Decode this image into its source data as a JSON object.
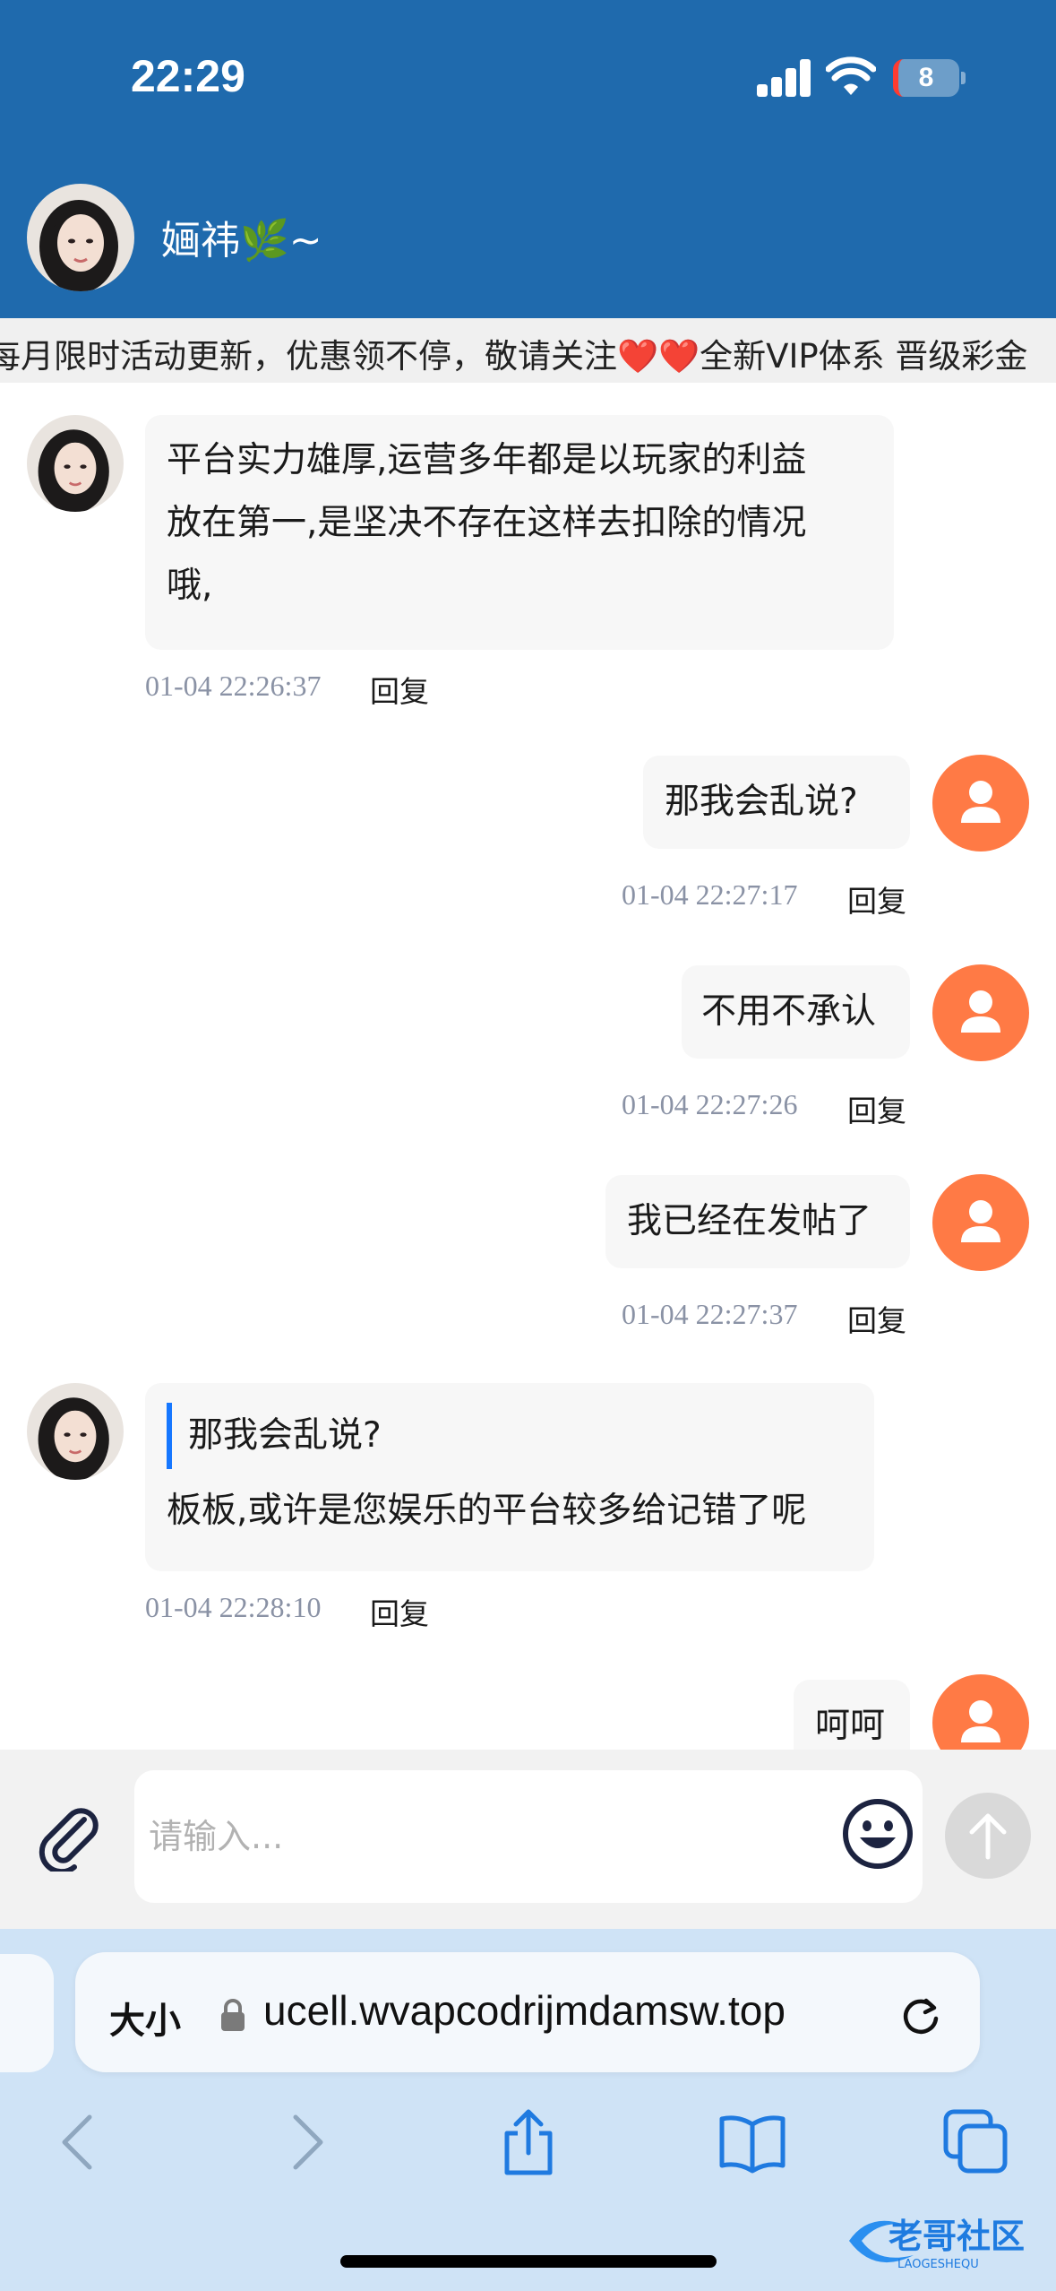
{
  "status_bar": {
    "time": "22:29",
    "battery_level": "8"
  },
  "header": {
    "contact_name": "婳祎🌿~"
  },
  "marquee": {
    "text": "每月限时活动更新，优惠领不停，敬请关注❤️❤️全新VIP体系 晋级彩金"
  },
  "messages": [
    {
      "side": "left",
      "lines": [
        "平台实力雄厚,运营多年都是以玩家的利益",
        "放在第一,是坚决不存在这样去扣除的情况",
        "哦,"
      ],
      "time": "01-04 22:26:37",
      "reply": "回复"
    },
    {
      "side": "right",
      "text": "那我会乱说?",
      "time": "01-04 22:27:17",
      "reply": "回复"
    },
    {
      "side": "right",
      "text": "不用不承认",
      "time": "01-04 22:27:26",
      "reply": "回复"
    },
    {
      "side": "right",
      "text": "我已经在发帖了",
      "time": "01-04 22:27:37",
      "reply": "回复"
    },
    {
      "side": "left",
      "quote": "那我会乱说?",
      "text": "板板,或许是您娱乐的平台较多给记错了呢",
      "time": "01-04 22:28:10",
      "reply": "回复"
    },
    {
      "side": "right",
      "text": "呵呵"
    }
  ],
  "input": {
    "placeholder": "请输入..."
  },
  "browser": {
    "text_size_label": "大小",
    "url": "ucell.wvapcodrijmdamsw.top"
  },
  "watermark": {
    "main": "老哥社区",
    "sub": "LAOGESHEQU"
  },
  "colors": {
    "header_bg": "#1f6aad",
    "my_avatar": "#ff7a45",
    "quote_bar": "#1677ff"
  }
}
